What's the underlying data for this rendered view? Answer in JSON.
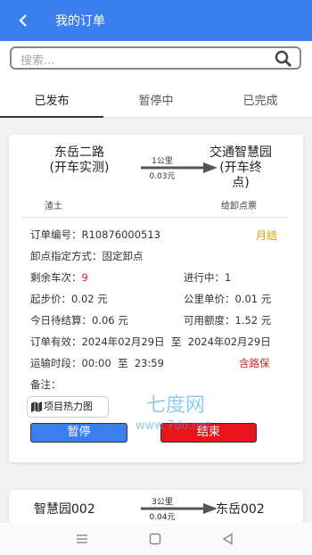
{
  "header": {
    "title": "我的订单"
  },
  "search": {
    "placeholder": "搜索..."
  },
  "tabs": [
    {
      "label": "已发布"
    },
    {
      "label": "暂停中"
    },
    {
      "label": "已完成"
    }
  ],
  "order1": {
    "from": "东岳二路\n(开车实测)",
    "to": "交通智慧园\n(开车终\n点)",
    "distance": "1公里",
    "price": "0.03元",
    "cargo": "渣土",
    "ticket": "给卸点票",
    "order_label": "订单编号：",
    "order_no": "R10876000513",
    "status": "月结",
    "unload_label": "卸点指定方式：",
    "unload_value": "固定卸点",
    "remain_label": "剩余车次：",
    "remain_value": "9",
    "inprogress_label": "进行中：",
    "inprogress_value": "1",
    "start_label": "起步价：",
    "start_value": "0.02 元",
    "unit_label": "公里单价：",
    "unit_value": "0.01 元",
    "settle_label": "今日待结算：",
    "settle_value": "0.06 元",
    "credit_label": "可用额度：",
    "credit_value": "1.52 元",
    "valid_label": "订单有效：",
    "valid_value": "2024年02月29日  至  2024年02月29日",
    "time_label": "运输时段：",
    "time_value": "00:00  至  23:59",
    "insurance": "含路保",
    "note_label": "备注：",
    "heatmap_label": "项目热力图",
    "pause_label": "暂停",
    "end_label": "结束"
  },
  "order2": {
    "from": "智慧园002",
    "to": "东岳002",
    "distance": "3公里",
    "price": "0.04元"
  },
  "watermark": {
    "text": "七度网",
    "url": "www.7do.net"
  },
  "colors": {
    "primary": "#3a7ef0",
    "danger": "#e8151a",
    "status": "#d4a000"
  }
}
